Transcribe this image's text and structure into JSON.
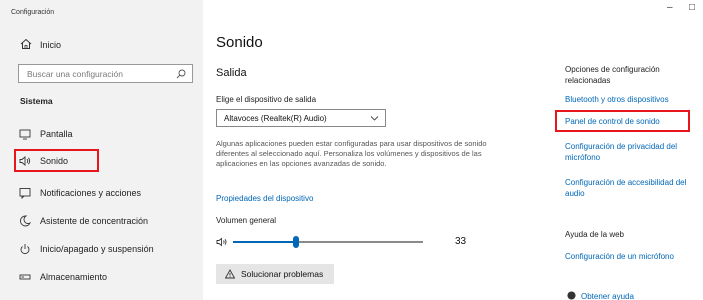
{
  "window": {
    "title": "Configuración",
    "minimize": "–",
    "maximize": "□"
  },
  "sidebar": {
    "home_label": "Inicio",
    "search_placeholder": "Buscar una configuración",
    "section_label": "Sistema",
    "items": [
      {
        "label": "Pantalla",
        "icon": "monitor-icon"
      },
      {
        "label": "Sonido",
        "icon": "speaker-icon",
        "selected": true
      },
      {
        "label": "Notificaciones y acciones",
        "icon": "notification-icon"
      },
      {
        "label": "Asistente de concentración",
        "icon": "moon-icon"
      },
      {
        "label": "Inicio/apagado y suspensión",
        "icon": "power-icon"
      },
      {
        "label": "Almacenamiento",
        "icon": "storage-icon"
      }
    ]
  },
  "main": {
    "title": "Sonido",
    "output_heading": "Salida",
    "output_device_label": "Elige el dispositivo de salida",
    "output_device_value": "Altavoces (Realtek(R) Audio)",
    "description": "Algunas aplicaciones pueden estar configuradas para usar dispositivos de sonido diferentes al seleccionado aquí. Personaliza los volúmenes y dispositivos de las aplicaciones en las opciones avanzadas de sonido.",
    "device_properties_link": "Propiedades del dispositivo",
    "volume_label": "Volumen general",
    "volume_value": "33",
    "volume_level": 0.33,
    "troubleshoot_label": "Solucionar problemas"
  },
  "related": {
    "heading": "Opciones de configuración relacionadas",
    "links": [
      "Bluetooth y otros dispositivos",
      "Panel de control de sonido",
      "Configuración de privacidad del micrófono",
      "Configuración de accesibilidad del audio"
    ],
    "web_help_heading": "Ayuda de la web",
    "web_help_link": "Configuración de un micrófono",
    "get_help": "Obtener ayuda"
  },
  "colors": {
    "accent": "#0067b8",
    "highlight": "#e8151b",
    "sidebar_bg": "#f2f2f2"
  }
}
